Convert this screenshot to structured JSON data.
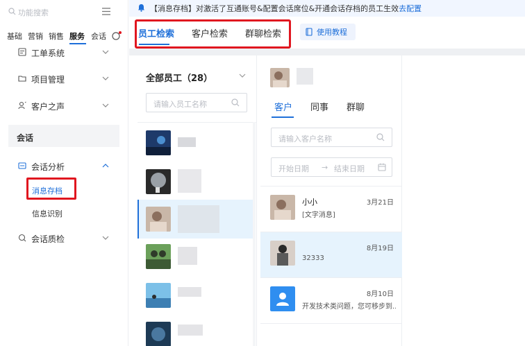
{
  "sidebar": {
    "search_placeholder": "功能搜索",
    "tabs": [
      "基础",
      "营销",
      "销售",
      "服务",
      "会话"
    ],
    "active_tab": "服务",
    "items": [
      {
        "label": "工单系统"
      },
      {
        "label": "项目管理"
      },
      {
        "label": "客户之声"
      }
    ],
    "section_label": "会话",
    "huihua_fenxi": {
      "label": "会话分析"
    },
    "sub_items": [
      {
        "label": "消息存档"
      },
      {
        "label": "信息识别"
      }
    ],
    "zhijian": {
      "label": "会话质检"
    }
  },
  "notice": {
    "text": "【消息存档】对激活了互通账号&配置会话席位&开通会话存档的员工生效",
    "link": "去配置"
  },
  "top_tabs": [
    {
      "label": "员工检索"
    },
    {
      "label": "客户检索"
    },
    {
      "label": "群聊检索"
    }
  ],
  "tutorial_button": {
    "label": "使用教程"
  },
  "employees": {
    "title": "全部员工（28）",
    "search_placeholder": "请输入员工名称"
  },
  "customer_panel": {
    "tabs": [
      {
        "label": "客户"
      },
      {
        "label": "同事"
      },
      {
        "label": "群聊"
      }
    ],
    "search_placeholder": "请输入客户名称",
    "date_start_placeholder": "开始日期",
    "date_arrow": "→",
    "date_end_placeholder": "结束日期",
    "conversations": [
      {
        "name": "小小",
        "date": "3月21日",
        "message": "[文字消息]"
      },
      {
        "name": "",
        "date": "8月19日",
        "message": "32333"
      },
      {
        "name": "",
        "date": "8月10日",
        "message": "开发技术类问题，您可移步到..."
      }
    ]
  },
  "colors": {
    "accent": "#1e6fd9",
    "highlight_border": "#e0161f",
    "active_row_bg": "#e6f3fd"
  }
}
